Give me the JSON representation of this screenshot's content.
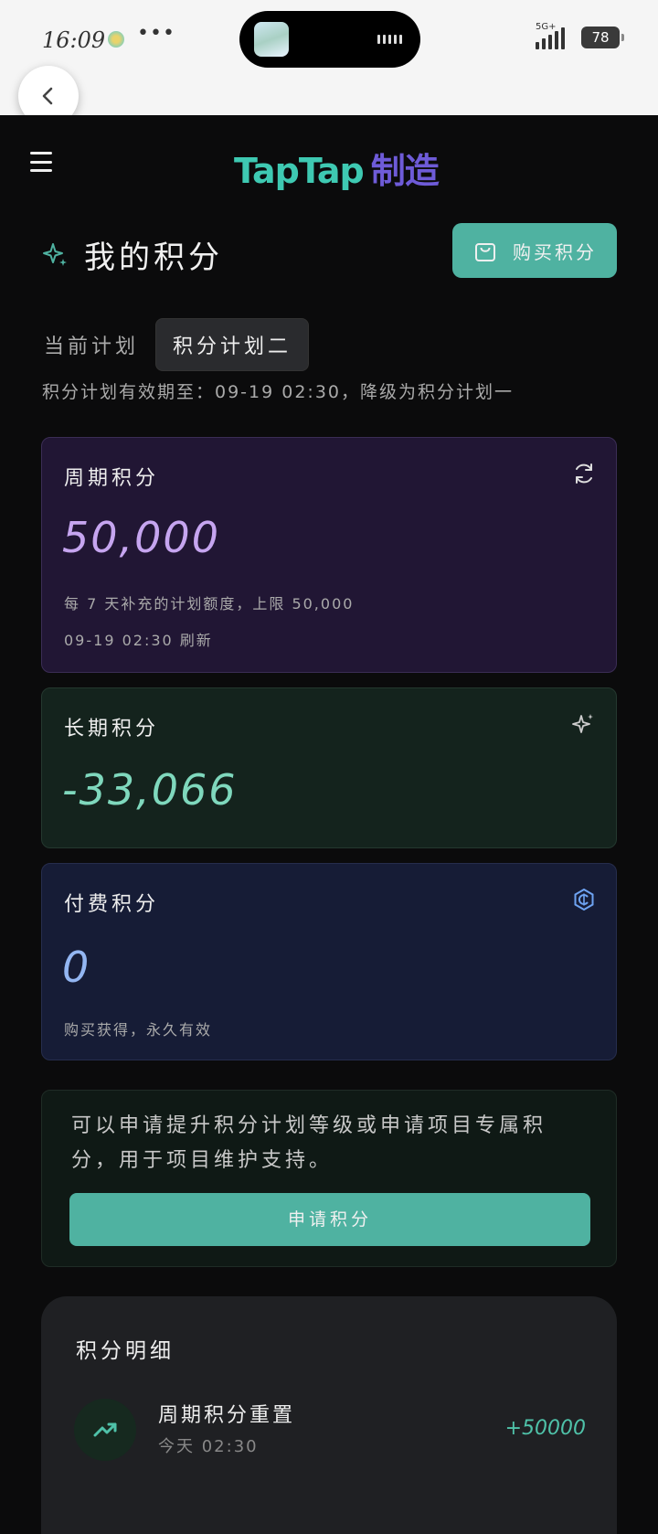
{
  "status_bar": {
    "time": "16:09",
    "more": "•••",
    "network": "5G+",
    "battery": "78"
  },
  "header": {
    "logo_primary": "TapTap",
    "logo_secondary": "制造"
  },
  "title": "我的积分",
  "buy_button": "购买积分",
  "plan": {
    "label": "当前计划",
    "current": "积分计划二",
    "note": "积分计划有效期至：09-19 02:30，降级为积分计划一"
  },
  "cards": [
    {
      "title": "周期积分",
      "value": "50,000",
      "desc": "每 7 天补充的计划额度，上限 50,000",
      "desc2": "09-19 02:30 刷新",
      "icon": "refresh-icon"
    },
    {
      "title": "长期积分",
      "value": "-33,066",
      "icon": "sparkle-icon"
    },
    {
      "title": "付费积分",
      "value": "0",
      "desc": "购买获得，永久有效",
      "icon": "coin-icon"
    }
  ],
  "apply": {
    "text": "可以申请提升积分计划等级或申请项目专属积分，用于项目维护支持。",
    "button": "申请积分"
  },
  "details": {
    "title": "积分明细",
    "items": [
      {
        "title": "周期积分重置",
        "time": "今天 02:30",
        "amount": "+50000",
        "icon": "trend-up-icon"
      }
    ]
  },
  "colors": {
    "accent": "#4fb2a1",
    "logo_green": "#3ec9b2",
    "logo_purple": "#6e5bd8"
  }
}
